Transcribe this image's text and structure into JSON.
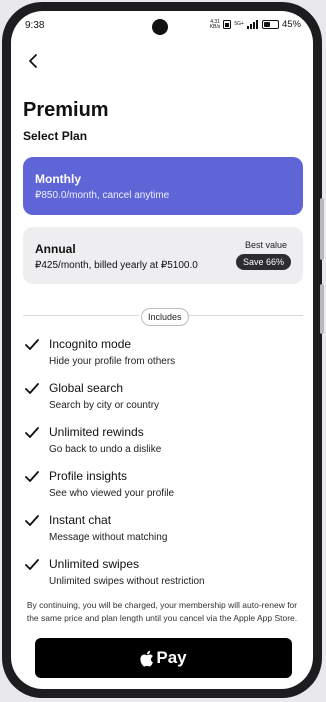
{
  "status_bar": {
    "time": "9:38",
    "net_speed_value": "4.31",
    "net_speed_unit": "KB/s",
    "network": "5G+",
    "battery": "45%"
  },
  "header": {
    "back_icon": "chevron-left-icon",
    "title": "Premium",
    "subtitle": "Select Plan"
  },
  "plans": [
    {
      "name": "Monthly",
      "desc": "₽850.0/month, cancel anytime",
      "selected": true,
      "color": "#5f64d6"
    },
    {
      "name": "Annual",
      "desc": "₽425/month, billed yearly at ₽5100.0",
      "badge_top": "Best value",
      "badge": "Save 66%",
      "selected": false
    }
  ],
  "includes_label": "Includes",
  "features": [
    {
      "name": "Incognito mode",
      "desc": "Hide your profile from others"
    },
    {
      "name": "Global search",
      "desc": "Search by city or country"
    },
    {
      "name": "Unlimited rewinds",
      "desc": "Go back to undo a dislike"
    },
    {
      "name": "Profile insights",
      "desc": "See who viewed your profile"
    },
    {
      "name": "Instant chat",
      "desc": "Message without matching"
    },
    {
      "name": "Unlimited swipes",
      "desc": "Unlimited swipes without restriction"
    }
  ],
  "legal": "By continuing, you will be charged, your membership will auto-renew for the same price and plan length until you cancel via the Apple App Store.",
  "pay_button": {
    "label": "Pay",
    "icon": "apple-logo-icon"
  }
}
